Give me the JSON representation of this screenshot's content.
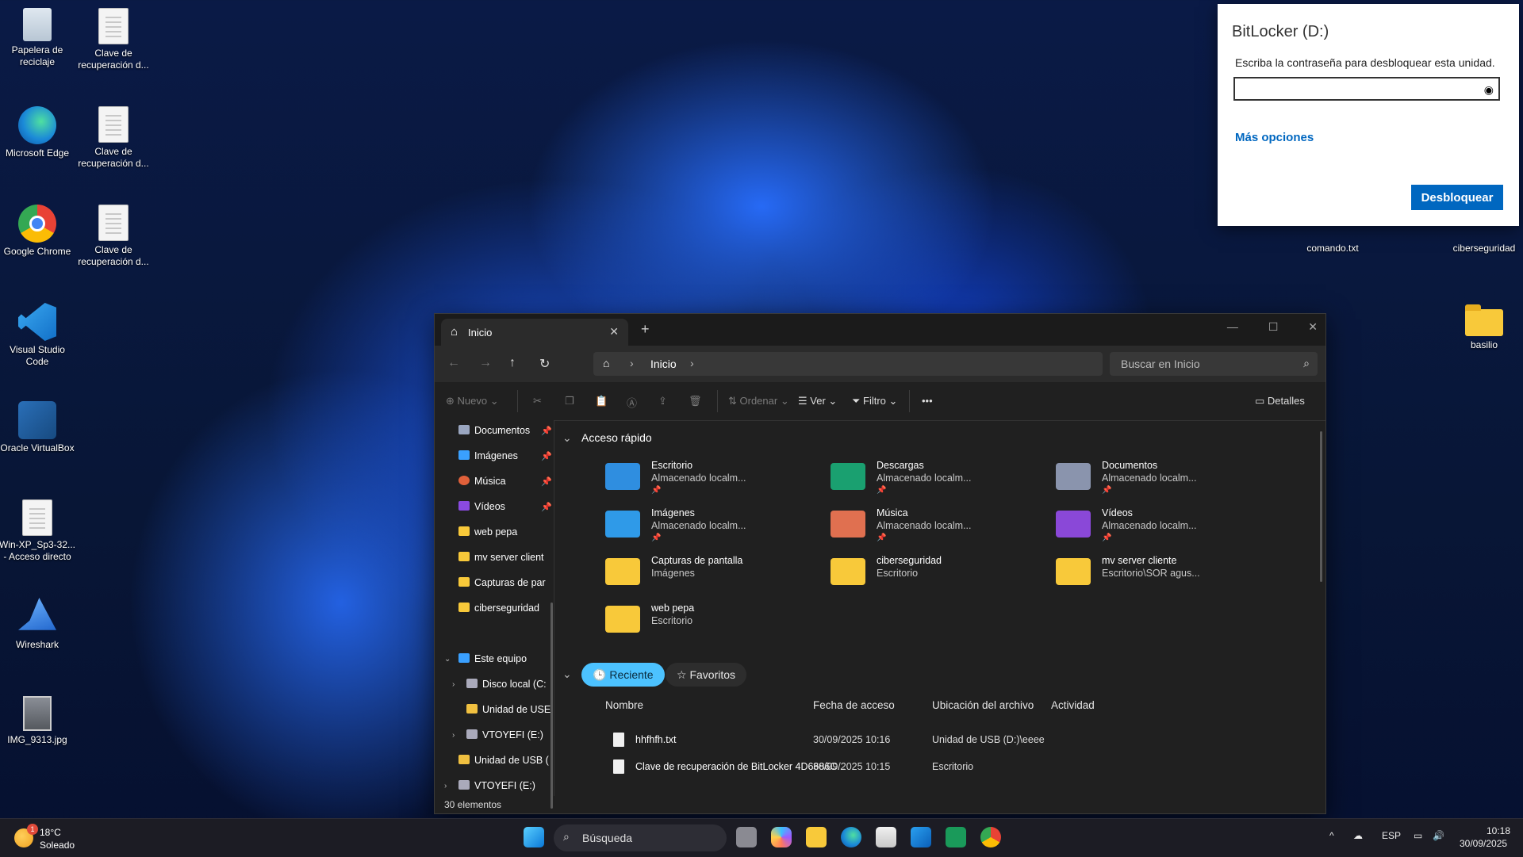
{
  "desktop": {
    "icons": [
      {
        "label": "Papelera de reciclaje",
        "icon": "recycle-bin-icon"
      },
      {
        "label": "Clave de recuperación d...",
        "icon": "text-document-icon"
      },
      {
        "label": "Microsoft Edge",
        "icon": "edge-icon"
      },
      {
        "label": "Clave de recuperación d...",
        "icon": "text-document-icon"
      },
      {
        "label": "Google Chrome",
        "icon": "chrome-icon"
      },
      {
        "label": "Clave de recuperación d...",
        "icon": "text-document-icon"
      },
      {
        "label": "Visual Studio Code",
        "icon": "vscode-icon"
      },
      {
        "label": "Oracle VirtualBox",
        "icon": "virtualbox-icon"
      },
      {
        "label": "Win-XP_Sp3-32... - Acceso directo",
        "icon": "shortcut-icon"
      },
      {
        "label": "Wireshark",
        "icon": "wireshark-icon"
      },
      {
        "label": "IMG_9313.jpg",
        "icon": "image-file-icon"
      },
      {
        "label": "comando.txt",
        "icon": "text-document-icon"
      },
      {
        "label": "ciberseguridad",
        "icon": "folder-icon"
      },
      {
        "label": "basilio",
        "icon": "folder-icon"
      }
    ]
  },
  "bitlocker": {
    "title": "BitLocker (D:)",
    "prompt": "Escriba la contraseña para desbloquear esta unidad.",
    "more_options": "Más opciones",
    "unlock_label": "Desbloquear"
  },
  "explorer": {
    "tab_label": "Inicio",
    "breadcrumb": "Inicio",
    "search_placeholder": "Buscar en Inicio",
    "commands": {
      "new": "Nuevo",
      "sort": "Ordenar",
      "view": "Ver",
      "filter": "Filtro",
      "details": "Detalles"
    },
    "sidebar": [
      {
        "label": "Documentos",
        "pinned": true,
        "color": "#9aa6c0"
      },
      {
        "label": "Imágenes",
        "pinned": true,
        "color": "#3aa0ff"
      },
      {
        "label": "Música",
        "pinned": true,
        "color": "#e0603a"
      },
      {
        "label": "Vídeos",
        "pinned": true,
        "color": "#8a4ae0"
      },
      {
        "label": "web pepa",
        "pinned": false,
        "color": "#f8c93a"
      },
      {
        "label": "mv server client",
        "pinned": false,
        "color": "#f8c93a"
      },
      {
        "label": "Capturas de par",
        "pinned": false,
        "color": "#f8c93a"
      },
      {
        "label": "ciberseguridad",
        "pinned": false,
        "color": "#f8c93a"
      },
      {
        "label": "Este equipo",
        "pinned": false,
        "color": "#3aa0ff"
      },
      {
        "label": "Disco local (C:",
        "pinned": false,
        "color": "#aab"
      },
      {
        "label": "Unidad de USE",
        "pinned": false,
        "color": "#f0c040"
      },
      {
        "label": "VTOYEFI (E:)",
        "pinned": false,
        "color": "#aab"
      },
      {
        "label": "Unidad de USB (",
        "pinned": false,
        "color": "#f0c040"
      },
      {
        "label": "VTOYEFI (E:)",
        "pinned": false,
        "color": "#aab"
      }
    ],
    "quick_access_title": "Acceso rápido",
    "quick_access": [
      {
        "name": "Escritorio",
        "sub": "Almacenado localm...",
        "pinned": true,
        "color": "#2f8ee0"
      },
      {
        "name": "Descargas",
        "sub": "Almacenado localm...",
        "pinned": true,
        "color": "#1aa070"
      },
      {
        "name": "Documentos",
        "sub": "Almacenado localm...",
        "pinned": true,
        "color": "#8a94ad"
      },
      {
        "name": "Imágenes",
        "sub": "Almacenado localm...",
        "pinned": true,
        "color": "#2f9ae8"
      },
      {
        "name": "Música",
        "sub": "Almacenado localm...",
        "pinned": true,
        "color": "#e07050"
      },
      {
        "name": "Vídeos",
        "sub": "Almacenado localm...",
        "pinned": true,
        "color": "#8a48d8"
      },
      {
        "name": "Capturas de pantalla",
        "sub": "Imágenes",
        "pinned": false,
        "color": "#f8c93a"
      },
      {
        "name": "ciberseguridad",
        "sub": "Escritorio",
        "pinned": false,
        "color": "#f8c93a"
      },
      {
        "name": "mv server cliente",
        "sub": "Escritorio\\SOR agus...",
        "pinned": false,
        "color": "#f8c93a"
      },
      {
        "name": "web pepa",
        "sub": "Escritorio",
        "pinned": false,
        "color": "#f8c93a"
      }
    ],
    "filters": {
      "recent": "Reciente",
      "favorites": "Favoritos"
    },
    "columns": [
      "Nombre",
      "Fecha de acceso",
      "Ubicación del archivo",
      "Actividad"
    ],
    "recent_files": [
      {
        "name": "hhfhfh.txt",
        "date": "30/09/2025 10:16",
        "location": "Unidad de USB (D:)\\eeee"
      },
      {
        "name": "Clave de recuperación de BitLocker 4D6686C...",
        "date": "30/09/2025 10:15",
        "location": "Escritorio"
      }
    ],
    "status": "30 elementos"
  },
  "taskbar": {
    "weather_temp": "18°C",
    "weather_desc": "Soleado",
    "weather_badge": "1",
    "search_label": "Búsqueda",
    "lang": "ESP",
    "time": "10:18",
    "date": "30/09/2025"
  }
}
